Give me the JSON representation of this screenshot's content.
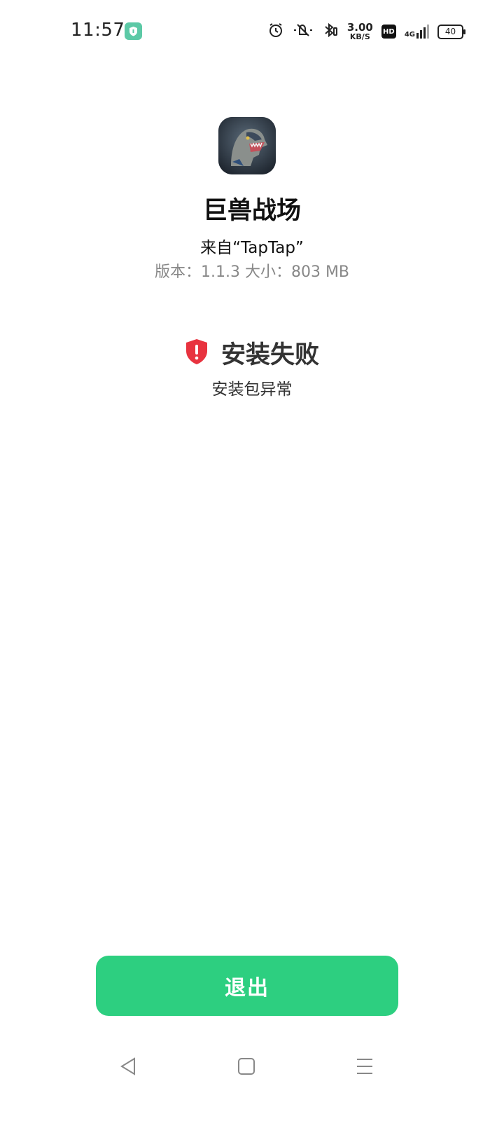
{
  "status_bar": {
    "time": "11:57",
    "speed_value": "3.00",
    "speed_unit": "KB/S",
    "hd_label": "HD",
    "network_label": "4G",
    "battery_level": "40",
    "icons": [
      "shield-app-icon",
      "alarm-icon",
      "mute-icon",
      "bluetooth-icon",
      "signal-icon",
      "battery-icon"
    ]
  },
  "app": {
    "name": "巨兽战场",
    "source": "来自“TapTap”",
    "meta": "版本：1.1.3   大小：803 MB"
  },
  "result": {
    "title": "安装失败",
    "subtitle": "安装包异常",
    "error_color": "#e8333f"
  },
  "actions": {
    "exit_label": "退出",
    "accent_color": "#2dcf80"
  },
  "nav": {
    "buttons": [
      "back-icon",
      "home-icon",
      "menu-icon"
    ]
  }
}
